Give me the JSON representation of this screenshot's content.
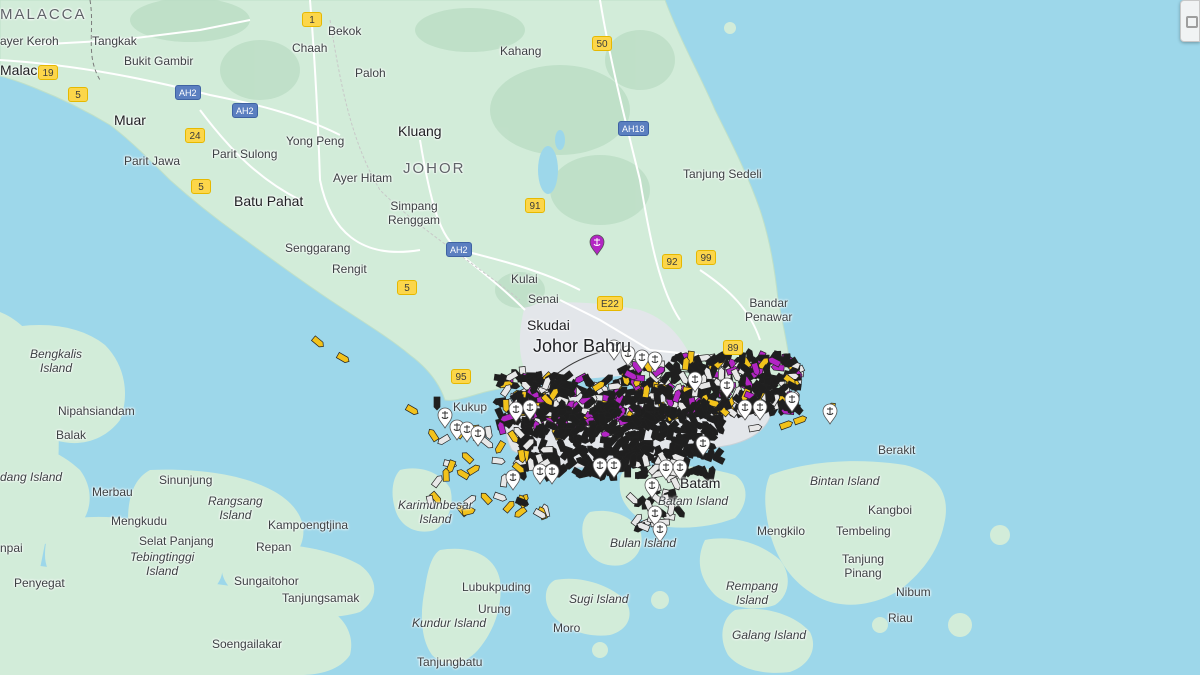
{
  "place_labels": [
    {
      "id": "malacca-state",
      "text": "MALACCA",
      "cls": "state"
    },
    {
      "id": "ayer-keroh",
      "text": "ayer Keroh",
      "cls": ""
    },
    {
      "id": "tangkak",
      "text": "Tangkak",
      "cls": ""
    },
    {
      "id": "chaah",
      "text": "Chaah",
      "cls": ""
    },
    {
      "id": "bekok",
      "text": "Bekok",
      "cls": ""
    },
    {
      "id": "kahang",
      "text": "Kahang",
      "cls": ""
    },
    {
      "id": "paloh",
      "text": "Paloh",
      "cls": ""
    },
    {
      "id": "malacca-city",
      "text": "Malacca",
      "cls": "city"
    },
    {
      "id": "bukit-gambir",
      "text": "Bukit Gambir",
      "cls": ""
    },
    {
      "id": "muar",
      "text": "Muar",
      "cls": "city"
    },
    {
      "id": "kluang",
      "text": "Kluang",
      "cls": "city"
    },
    {
      "id": "yong-peng",
      "text": "Yong Peng",
      "cls": ""
    },
    {
      "id": "parit-jawa",
      "text": "Parit Jawa",
      "cls": ""
    },
    {
      "id": "parit-sulong",
      "text": "Parit Sulong",
      "cls": ""
    },
    {
      "id": "ayer-hitam",
      "text": "Ayer Hitam",
      "cls": ""
    },
    {
      "id": "johor-state",
      "text": "JOHOR",
      "cls": "state"
    },
    {
      "id": "tanjung-sedeli",
      "text": "Tanjung Sedeli",
      "cls": ""
    },
    {
      "id": "batu-pahat",
      "text": "Batu Pahat",
      "cls": "city"
    },
    {
      "id": "simpang-renggam",
      "text": "Simpang\nRenggam",
      "cls": ""
    },
    {
      "id": "senggarang",
      "text": "Senggarang",
      "cls": ""
    },
    {
      "id": "rengit",
      "text": "Rengit",
      "cls": ""
    },
    {
      "id": "kulai",
      "text": "Kulai",
      "cls": ""
    },
    {
      "id": "senai",
      "text": "Senai",
      "cls": ""
    },
    {
      "id": "bandar-penawar",
      "text": "Bandar\nPenawar",
      "cls": ""
    },
    {
      "id": "skudai",
      "text": "Skudai",
      "cls": "city"
    },
    {
      "id": "johor-bahru",
      "text": "Johor Bahru",
      "cls": "big"
    },
    {
      "id": "bengkalis-island",
      "text": "Bengkalis\nIsland",
      "cls": "water"
    },
    {
      "id": "nipahsiandam",
      "text": "Nipahsiandam",
      "cls": ""
    },
    {
      "id": "kukup",
      "text": "Kukup",
      "cls": ""
    },
    {
      "id": "balak",
      "text": "Balak",
      "cls": ""
    },
    {
      "id": "berakit",
      "text": "Berakit",
      "cls": ""
    },
    {
      "id": "padang-island",
      "text": "dang Island",
      "cls": "water"
    },
    {
      "id": "sinunjung",
      "text": "Sinunjung",
      "cls": ""
    },
    {
      "id": "bintan-island",
      "text": "Bintan Island",
      "cls": "water"
    },
    {
      "id": "merbau",
      "text": "Merbau",
      "cls": ""
    },
    {
      "id": "rangsang-island",
      "text": "Rangsang\nIsland",
      "cls": "water"
    },
    {
      "id": "karimunbesar-island",
      "text": "Karimunbesar\nIsland",
      "cls": "water"
    },
    {
      "id": "batam",
      "text": "Batam",
      "cls": "city"
    },
    {
      "id": "batam-island",
      "text": "Batam Island",
      "cls": "water"
    },
    {
      "id": "kangboi",
      "text": "Kangboi",
      "cls": ""
    },
    {
      "id": "mengkudu",
      "text": "Mengkudu",
      "cls": ""
    },
    {
      "id": "kampoengtjina",
      "text": "Kampoengtjina",
      "cls": ""
    },
    {
      "id": "mengkilo",
      "text": "Mengkilo",
      "cls": ""
    },
    {
      "id": "tembeling",
      "text": "Tembeling",
      "cls": ""
    },
    {
      "id": "selat-panjang",
      "text": "Selat Panjang",
      "cls": ""
    },
    {
      "id": "repan",
      "text": "Repan",
      "cls": ""
    },
    {
      "id": "bulan-island",
      "text": "Bulan Island",
      "cls": "water"
    },
    {
      "id": "pai",
      "text": "npai",
      "cls": ""
    },
    {
      "id": "tebingtinggi-island",
      "text": "Tebingtinggi\nIsland",
      "cls": "water"
    },
    {
      "id": "tanjung-pinang",
      "text": "Tanjung\nPinang",
      "cls": ""
    },
    {
      "id": "penyegat",
      "text": "Penyegat",
      "cls": ""
    },
    {
      "id": "sungaitohor",
      "text": "Sungaitohor",
      "cls": ""
    },
    {
      "id": "lubukpuding",
      "text": "Lubukpuding",
      "cls": ""
    },
    {
      "id": "rempang-island",
      "text": "Rempang\nIsland",
      "cls": "water"
    },
    {
      "id": "nibum",
      "text": "Nibum",
      "cls": ""
    },
    {
      "id": "tanjungsamak",
      "text": "Tanjungsamak",
      "cls": ""
    },
    {
      "id": "sugi-island",
      "text": "Sugi Island",
      "cls": "water"
    },
    {
      "id": "urung",
      "text": "Urung",
      "cls": ""
    },
    {
      "id": "riau",
      "text": "Riau",
      "cls": ""
    },
    {
      "id": "kundur-island",
      "text": "Kundur Island",
      "cls": "water"
    },
    {
      "id": "moro",
      "text": "Moro",
      "cls": ""
    },
    {
      "id": "galang-island",
      "text": "Galang Island",
      "cls": "water"
    },
    {
      "id": "soengailakar",
      "text": "Soengailakar",
      "cls": ""
    },
    {
      "id": "tanjungbatu",
      "text": "Tanjungbatu",
      "cls": ""
    }
  ],
  "road_shields": [
    {
      "id": "route-1",
      "text": "1",
      "type": "y"
    },
    {
      "id": "route-50",
      "text": "50",
      "type": "y"
    },
    {
      "id": "route-19",
      "text": "19",
      "type": "y"
    },
    {
      "id": "route-5-north",
      "text": "5",
      "type": "y"
    },
    {
      "id": "ah2-west",
      "text": "AH2",
      "type": "b"
    },
    {
      "id": "ah2-mid",
      "text": "AH2",
      "type": "b"
    },
    {
      "id": "route-24",
      "text": "24",
      "type": "y"
    },
    {
      "id": "ah18",
      "text": "AH18",
      "type": "b"
    },
    {
      "id": "route-5-mid",
      "text": "5",
      "type": "y"
    },
    {
      "id": "route-91",
      "text": "91",
      "type": "y"
    },
    {
      "id": "ah2-south",
      "text": "AH2",
      "type": "b"
    },
    {
      "id": "route-92",
      "text": "92",
      "type": "y"
    },
    {
      "id": "route-99",
      "text": "99",
      "type": "y"
    },
    {
      "id": "route-5-south",
      "text": "5",
      "type": "y"
    },
    {
      "id": "e22",
      "text": "E22",
      "type": "y"
    },
    {
      "id": "route-89",
      "text": "89",
      "type": "y"
    },
    {
      "id": "route-95",
      "text": "95",
      "type": "y"
    }
  ],
  "colors": {
    "water": "#9dd7ea",
    "land": "#d2ecd9",
    "urban": "#e2e6e9",
    "vessel_cargo": "#1f1f1f",
    "vessel_tanker": "#f2c21b",
    "vessel_passenger": "#b325c4",
    "vessel_other": "#e8e8e8"
  },
  "icons": {
    "marker_anchor": "anchor-icon",
    "marker_poi": "map-pin-icon",
    "corner": "map-layers-icon"
  }
}
